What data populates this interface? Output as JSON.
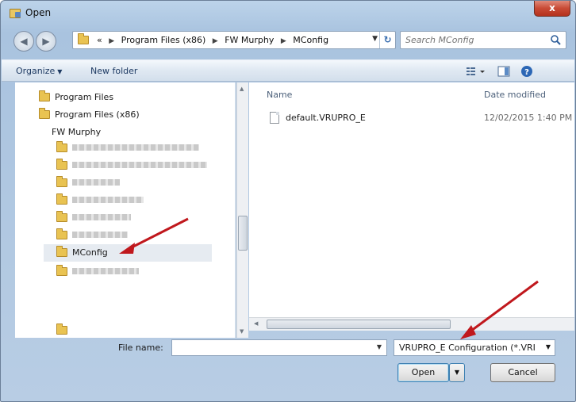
{
  "window": {
    "title": "Open",
    "close_glyph": "x"
  },
  "address_bar": {
    "overflow_glyph": "«",
    "crumbs": [
      "Program Files (x86)",
      "FW Murphy",
      "MConfig"
    ]
  },
  "search": {
    "placeholder": "Search MConfig"
  },
  "command_bar": {
    "organize": "Organize",
    "new_folder": "New folder"
  },
  "tree": {
    "items": [
      {
        "label": "Program Files"
      },
      {
        "label": "Program Files (x86)"
      },
      {
        "label": "FW Murphy"
      },
      {
        "label": "MConfig"
      }
    ]
  },
  "file_list": {
    "columns": {
      "name": "Name",
      "date_modified": "Date modified"
    },
    "files": [
      {
        "name": "default.VRUPRO_E",
        "date": "12/02/2015 1:40 PM"
      }
    ]
  },
  "bottom": {
    "file_name_label": "File name:",
    "file_name_value": "",
    "filter_value": "VRUPRO_E Configuration (*.VRI",
    "open_label": "Open",
    "cancel_label": "Cancel"
  },
  "colors": {
    "annotation_arrow": "#c0181d",
    "title_bar": "#a9c3df"
  }
}
